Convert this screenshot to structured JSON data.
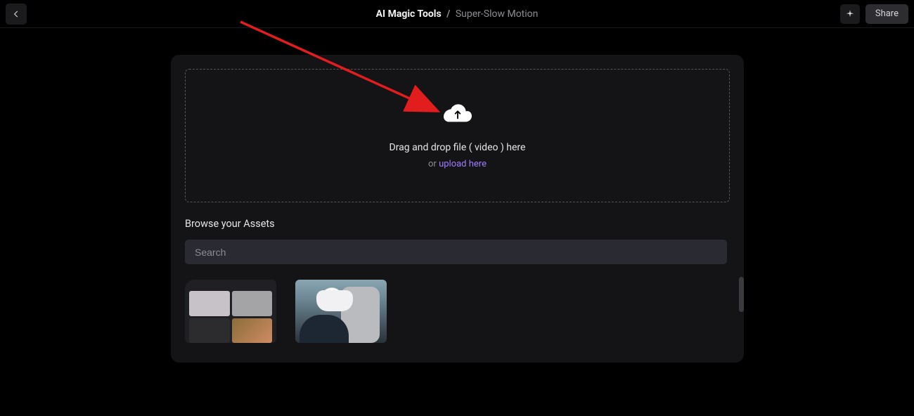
{
  "header": {
    "breadcrumb_main": "AI Magic Tools",
    "breadcrumb_separator": "/",
    "breadcrumb_sub": "Super-Slow Motion",
    "share_label": "Share"
  },
  "dropzone": {
    "line1": "Drag and drop file ( video ) here",
    "or_text": "or ",
    "upload_link": "upload here"
  },
  "assets": {
    "title": "Browse your Assets",
    "search_placeholder": "Search"
  }
}
